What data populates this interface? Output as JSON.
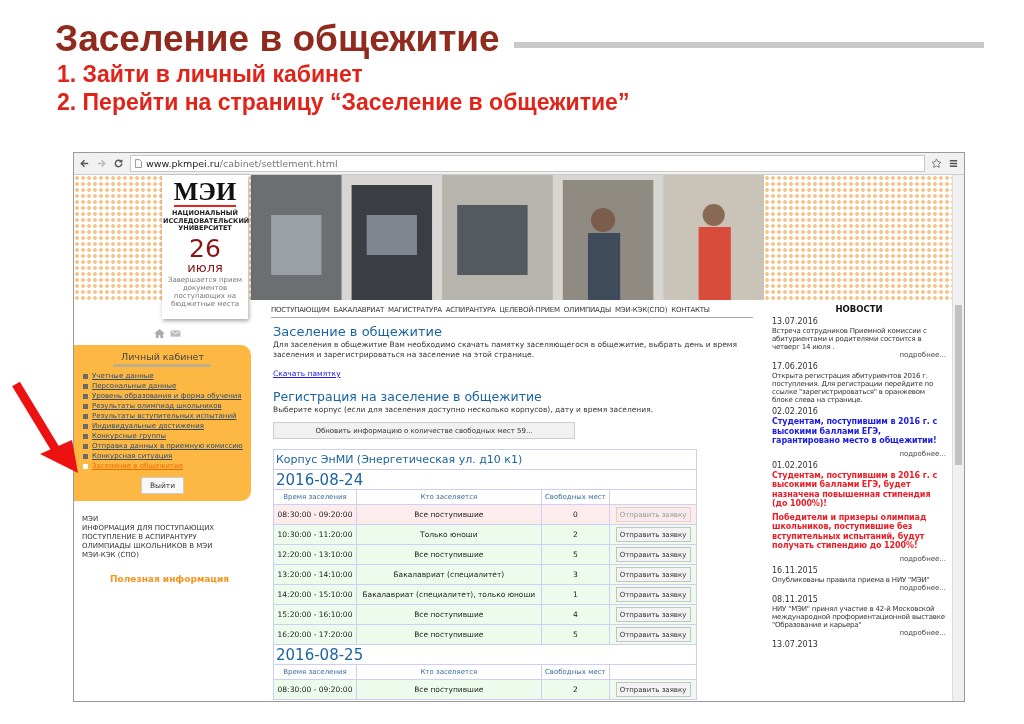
{
  "slide": {
    "title": "Заселение в общежитие",
    "steps": [
      "1. Зайти в личный кабинет",
      "2. Перейти на страницу “Заселение в общежитие”"
    ]
  },
  "browser": {
    "url": "**www.pkmpei.ru**/cabinet/settlement.html"
  },
  "logo": {
    "name": "МЭИ",
    "subtitle": "НАЦИОНАЛЬНЫЙ ИССЛЕДОВАТЕЛЬСКИЙ УНИВЕРСИТЕТ",
    "day": "26",
    "month": "июля",
    "note": "Завершается прием документов поступающих на бюджетные места"
  },
  "nav": [
    "ПОСТУПАЮЩИМ",
    "БАКАЛАВРИАТ",
    "МАГИСТРАТУРА",
    "АСПИРАНТУРА",
    "ЦЕЛЕВОЙ-ПРИЕМ",
    "ОЛИМПИАДЫ",
    "МЭИ-КЭК(СПО)",
    "КОНТАКТЫ"
  ],
  "cabinet": {
    "title": "Личный кабинет",
    "items": [
      {
        "label": "Учетные данные",
        "selected": false
      },
      {
        "label": "Персональные данные",
        "selected": false
      },
      {
        "label": "Уровень образования и форма обучения",
        "selected": false
      },
      {
        "label": "Результаты олимпиад школьников",
        "selected": false
      },
      {
        "label": "Результаты вступительных испытаний",
        "selected": false
      },
      {
        "label": "Индивидуальные достижения",
        "selected": false
      },
      {
        "label": "Конкурсные группы",
        "selected": false
      },
      {
        "label": "Отправка данных в приемную комиссию",
        "selected": false
      },
      {
        "label": "Конкурсная ситуация",
        "selected": false
      },
      {
        "label": "Заселение в общежитие",
        "selected": true
      }
    ],
    "logout": "Выйти"
  },
  "links": [
    "МЭИ",
    "ИНФОРМАЦИЯ ДЛЯ ПОСТУПАЮЩИХ",
    "ПОСТУПЛЕНИЕ В АСПИРАНТУРУ",
    "ОЛИМПИАДЫ ШКОЛЬНИКОВ В МЭИ",
    "МЭИ-КЭК (СПО)"
  ],
  "useful": "Полезная информация",
  "content": {
    "title": "Заселение в общежитие",
    "intro": "Для заселения в общежитие Вам необходимо скачать памятку заселяющегося в общежитие, выбрать день и время заселения и зарегистрироваться на заселение на этой странице.",
    "download": "Скачать памятку",
    "subtitle": "Регистрация на заселение в общежитие",
    "hint": "Выберите корпус (если для заселения доступно несколько корпусов), дату и время заселения.",
    "refresh": "Обновить информацию о количестве свободных мест  59..."
  },
  "building": {
    "title": "Корпус ЭнМИ (Энергетическая ул. д10 к1)",
    "days": [
      {
        "date": "2016-08-24",
        "columns": [
          "Время заселения",
          "Кто заселяется",
          "Свободных мест"
        ],
        "rows": [
          {
            "time": "08:30:00 - 09:20:00",
            "who": "Все поступившие",
            "free": "0",
            "button": "Отправить заявку",
            "available": false
          },
          {
            "time": "10:30:00 - 11:20:00",
            "who": "Только юноши",
            "free": "2",
            "button": "Отправить заявку",
            "available": true
          },
          {
            "time": "12:20:00 - 13:10:00",
            "who": "Все поступившие",
            "free": "5",
            "button": "Отправить заявку",
            "available": true
          },
          {
            "time": "13:20:00 - 14:10:00",
            "who": "Бакалавриат (специалитет)",
            "free": "3",
            "button": "Отправить заявку",
            "available": true
          },
          {
            "time": "14:20:00 - 15:10:00",
            "who": "Бакалавриат (специалитет), только юноши",
            "free": "1",
            "button": "Отправить заявку",
            "available": true
          },
          {
            "time": "15:20:00 - 16:10:00",
            "who": "Все поступившие",
            "free": "4",
            "button": "Отправить заявку",
            "available": true
          },
          {
            "time": "16:20:00 - 17:20:00",
            "who": "Все поступившие",
            "free": "5",
            "button": "Отправить заявку",
            "available": true
          }
        ]
      },
      {
        "date": "2016-08-25",
        "columns": [
          "Время заселения",
          "Кто заселяется",
          "Свободных мест"
        ],
        "rows": [
          {
            "time": "08:30:00 - 09:20:00",
            "who": "Все поступившие",
            "free": "2",
            "button": "Отправить заявку",
            "available": true
          }
        ]
      }
    ]
  },
  "news": {
    "title": "НОВОСТИ",
    "items": [
      {
        "date": "13.07.2016",
        "kind": "plain",
        "paragraphs": [
          "Встреча сотрудников Приемной комиссии с абитуриентами и родителями состоится в четверг 14 июля ."
        ],
        "more": "подробнее..."
      },
      {
        "date": "17.06.2016",
        "kind": "plain",
        "paragraphs": [
          "Открыта регистрация абитуриентов 2016 г. поступления. Для регистрации перейдите по ссылке \"зарегистрироваться\" в оранжевом блоке слева на странице."
        ]
      },
      {
        "date": "02.02.2016",
        "kind": "headline",
        "color": "#1a1ae6",
        "paragraphs": [
          "Студентам, поступившим в 2016 г. с высокими баллами ЕГЭ, гарантировано место в общежитии!"
        ],
        "more": "подробнее..."
      },
      {
        "date": "01.02.2016",
        "kind": "headline",
        "color": "#ee1c25",
        "paragraphs": [
          "Студентам, поступившим в 2016 г. с высокими баллами ЕГЭ, будет назначена повышенная стипендия (до 1000%)!",
          "Победители и призеры олимпиад школьников, поступившие без вступительных испытаний, будут получать стипендию до 1200%!"
        ],
        "more": "подробнее..."
      },
      {
        "date": "16.11.2015",
        "kind": "plain",
        "paragraphs": [
          "Опубликованы правила приема в НИУ \"МЭИ\""
        ],
        "more": "подробнее..."
      },
      {
        "date": "08.11.2015",
        "kind": "plain",
        "paragraphs": [
          "НИУ \"МЭИ\" принял  участие в 42-й Московской международной профориентационной выставке \"Образование и карьера\""
        ],
        "more": "подробнее..."
      },
      {
        "date": "13.07.2013",
        "kind": "plain"
      }
    ]
  }
}
